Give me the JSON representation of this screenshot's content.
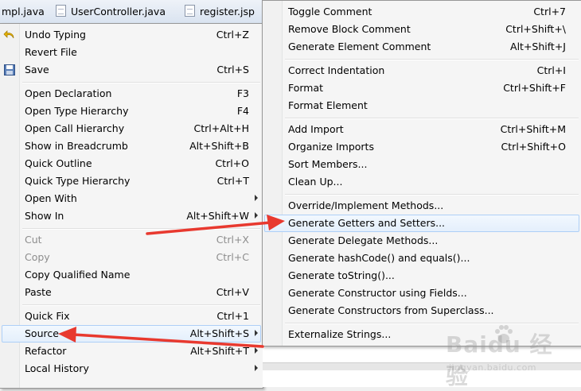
{
  "tabs": [
    {
      "label": "mpl.java"
    },
    {
      "label": "UserController.java"
    },
    {
      "label": "register.jsp"
    }
  ],
  "main_menu": {
    "items": [
      {
        "label": "Undo Typing",
        "accel": "Ctrl+Z",
        "icon": "undo-icon"
      },
      {
        "label": "Revert File",
        "accel": ""
      },
      {
        "label": "Save",
        "accel": "Ctrl+S",
        "icon": "save-icon"
      },
      {
        "label": "Open Declaration",
        "accel": "F3"
      },
      {
        "label": "Open Type Hierarchy",
        "accel": "F4"
      },
      {
        "label": "Open Call Hierarchy",
        "accel": "Ctrl+Alt+H"
      },
      {
        "label": "Show in Breadcrumb",
        "accel": "Alt+Shift+B"
      },
      {
        "label": "Quick Outline",
        "accel": "Ctrl+O"
      },
      {
        "label": "Quick Type Hierarchy",
        "accel": "Ctrl+T"
      },
      {
        "label": "Open With",
        "accel": ""
      },
      {
        "label": "Show In",
        "accel": "Alt+Shift+W"
      },
      {
        "label": "Cut",
        "accel": "Ctrl+X"
      },
      {
        "label": "Copy",
        "accel": "Ctrl+C"
      },
      {
        "label": "Copy Qualified Name",
        "accel": ""
      },
      {
        "label": "Paste",
        "accel": "Ctrl+V"
      },
      {
        "label": "Quick Fix",
        "accel": "Ctrl+1"
      },
      {
        "label": "Source",
        "accel": "Alt+Shift+S"
      },
      {
        "label": "Refactor",
        "accel": "Alt+Shift+T"
      },
      {
        "label": "Local History",
        "accel": ""
      }
    ]
  },
  "source_menu": {
    "items": [
      {
        "label": "Toggle Comment",
        "accel": "Ctrl+7"
      },
      {
        "label": "Remove Block Comment",
        "accel": "Ctrl+Shift+\\"
      },
      {
        "label": "Generate Element Comment",
        "accel": "Alt+Shift+J"
      },
      {
        "label": "Correct Indentation",
        "accel": "Ctrl+I"
      },
      {
        "label": "Format",
        "accel": "Ctrl+Shift+F"
      },
      {
        "label": "Format Element",
        "accel": ""
      },
      {
        "label": "Add Import",
        "accel": "Ctrl+Shift+M"
      },
      {
        "label": "Organize Imports",
        "accel": "Ctrl+Shift+O"
      },
      {
        "label": "Sort Members...",
        "accel": ""
      },
      {
        "label": "Clean Up...",
        "accel": ""
      },
      {
        "label": "Override/Implement Methods...",
        "accel": ""
      },
      {
        "label": "Generate Getters and Setters...",
        "accel": ""
      },
      {
        "label": "Generate Delegate Methods...",
        "accel": ""
      },
      {
        "label": "Generate hashCode() and equals()...",
        "accel": ""
      },
      {
        "label": "Generate toString()...",
        "accel": ""
      },
      {
        "label": "Generate Constructor using Fields...",
        "accel": ""
      },
      {
        "label": "Generate Constructors from Superclass...",
        "accel": ""
      },
      {
        "label": "Externalize Strings...",
        "accel": ""
      }
    ]
  },
  "watermark": {
    "brand": "Baidu 经验",
    "url": "jingyan.baidu.com"
  },
  "colors": {
    "annotation_arrow": "#e8392f",
    "highlight": "#cce4f7"
  }
}
